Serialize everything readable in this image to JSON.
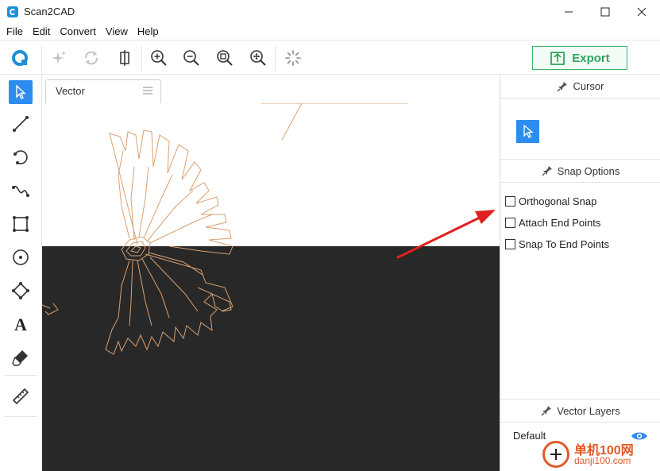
{
  "window": {
    "title": "Scan2CAD",
    "minimize_icon": "minimize-icon",
    "maximize_icon": "maximize-icon",
    "close_icon": "close-icon"
  },
  "menu": {
    "items": [
      {
        "label": "File"
      },
      {
        "label": "Edit"
      },
      {
        "label": "Convert"
      },
      {
        "label": "View"
      },
      {
        "label": "Help"
      }
    ]
  },
  "toolbar": {
    "export_label": "Export",
    "icons": [
      "logo-icon",
      "magic-icon",
      "refresh-icon",
      "crop-icon",
      "zoom-in-icon",
      "zoom-out-icon",
      "zoom-fit-icon",
      "zoom-all-icon",
      "spinner-icon"
    ]
  },
  "tools": {
    "items": [
      "select-icon",
      "line-icon",
      "arc-icon",
      "curve-icon",
      "rectangle-icon",
      "circle-icon",
      "polygon-icon",
      "text-icon",
      "eraser-icon",
      "ruler-icon"
    ]
  },
  "tabs": [
    {
      "label": "Vector"
    }
  ],
  "right_panel": {
    "cursor_header": "Cursor",
    "snap_header": "Snap Options",
    "snap_options": [
      {
        "label": "Orthogonal Snap",
        "checked": false
      },
      {
        "label": "Attach End Points",
        "checked": false
      },
      {
        "label": "Snap To End Points",
        "checked": false
      }
    ],
    "layers_header": "Vector Layers",
    "layers": [
      {
        "name": "Default",
        "visible": true
      }
    ]
  },
  "watermark": {
    "text": "单机100网",
    "sub": "danji100.com"
  },
  "colors": {
    "accent": "#2d8cf0",
    "export_green": "#2fa75f",
    "vector_stroke": "#d9a070",
    "canvas_dark": "#282828",
    "annotation_red": "#e02020"
  }
}
